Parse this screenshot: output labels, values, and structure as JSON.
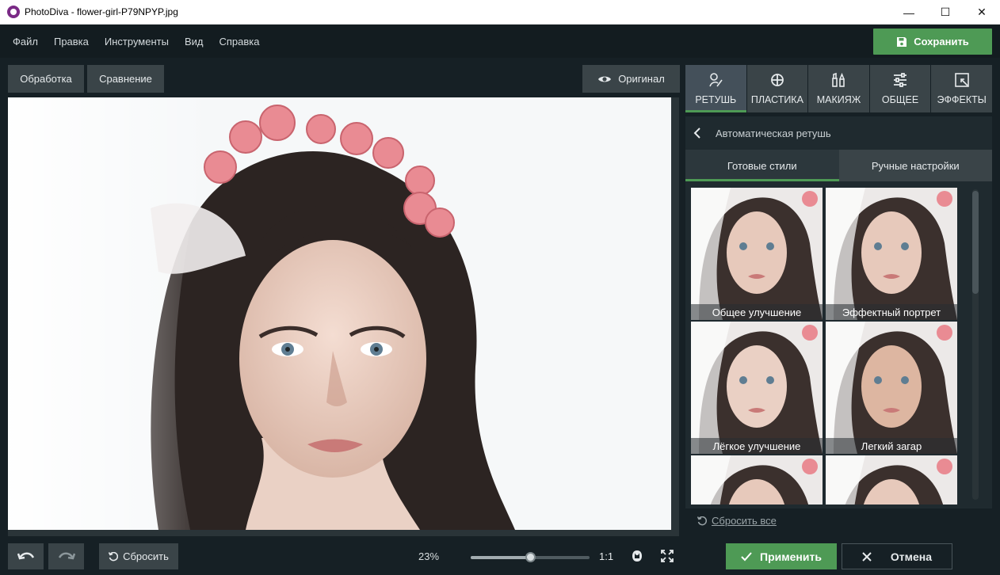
{
  "window": {
    "title": "PhotoDiva - flower-girl-P79NPYP.jpg",
    "controls": [
      "—",
      "☐",
      "✕"
    ]
  },
  "menu": {
    "items": [
      "Файл",
      "Правка",
      "Инструменты",
      "Вид",
      "Справка"
    ],
    "save_label": "Сохранить"
  },
  "toolbar": {
    "processing_label": "Обработка",
    "compare_label": "Сравнение",
    "original_label": "Оригинал"
  },
  "bottom": {
    "reset_label": "Сбросить",
    "zoom_percent": "23%",
    "zoom_fraction": 0.5,
    "one_to_one": "1:1"
  },
  "tabs": [
    {
      "label": "РЕТУШЬ",
      "icon": "brush-icon"
    },
    {
      "label": "ПЛАСТИКА",
      "icon": "crosshair-icon"
    },
    {
      "label": "МАКИЯЖ",
      "icon": "makeup-icon"
    },
    {
      "label": "ОБЩЕЕ",
      "icon": "sliders-icon"
    },
    {
      "label": "ЭФФЕКТЫ",
      "icon": "effects-icon"
    }
  ],
  "panel": {
    "header": "Автоматическая ретушь",
    "subtabs": [
      "Готовые стили",
      "Ручные настройки"
    ],
    "styles": [
      "Общее улучшение",
      "Эффектный портрет",
      "Лёгкое улучшение",
      "Легкий загар",
      "",
      ""
    ],
    "reset_all": "Сбросить все",
    "apply_label": "Применить",
    "cancel_label": "Отмена"
  },
  "colors": {
    "accent": "#4e9a55",
    "background": "#162025",
    "button": "#3a4448"
  }
}
